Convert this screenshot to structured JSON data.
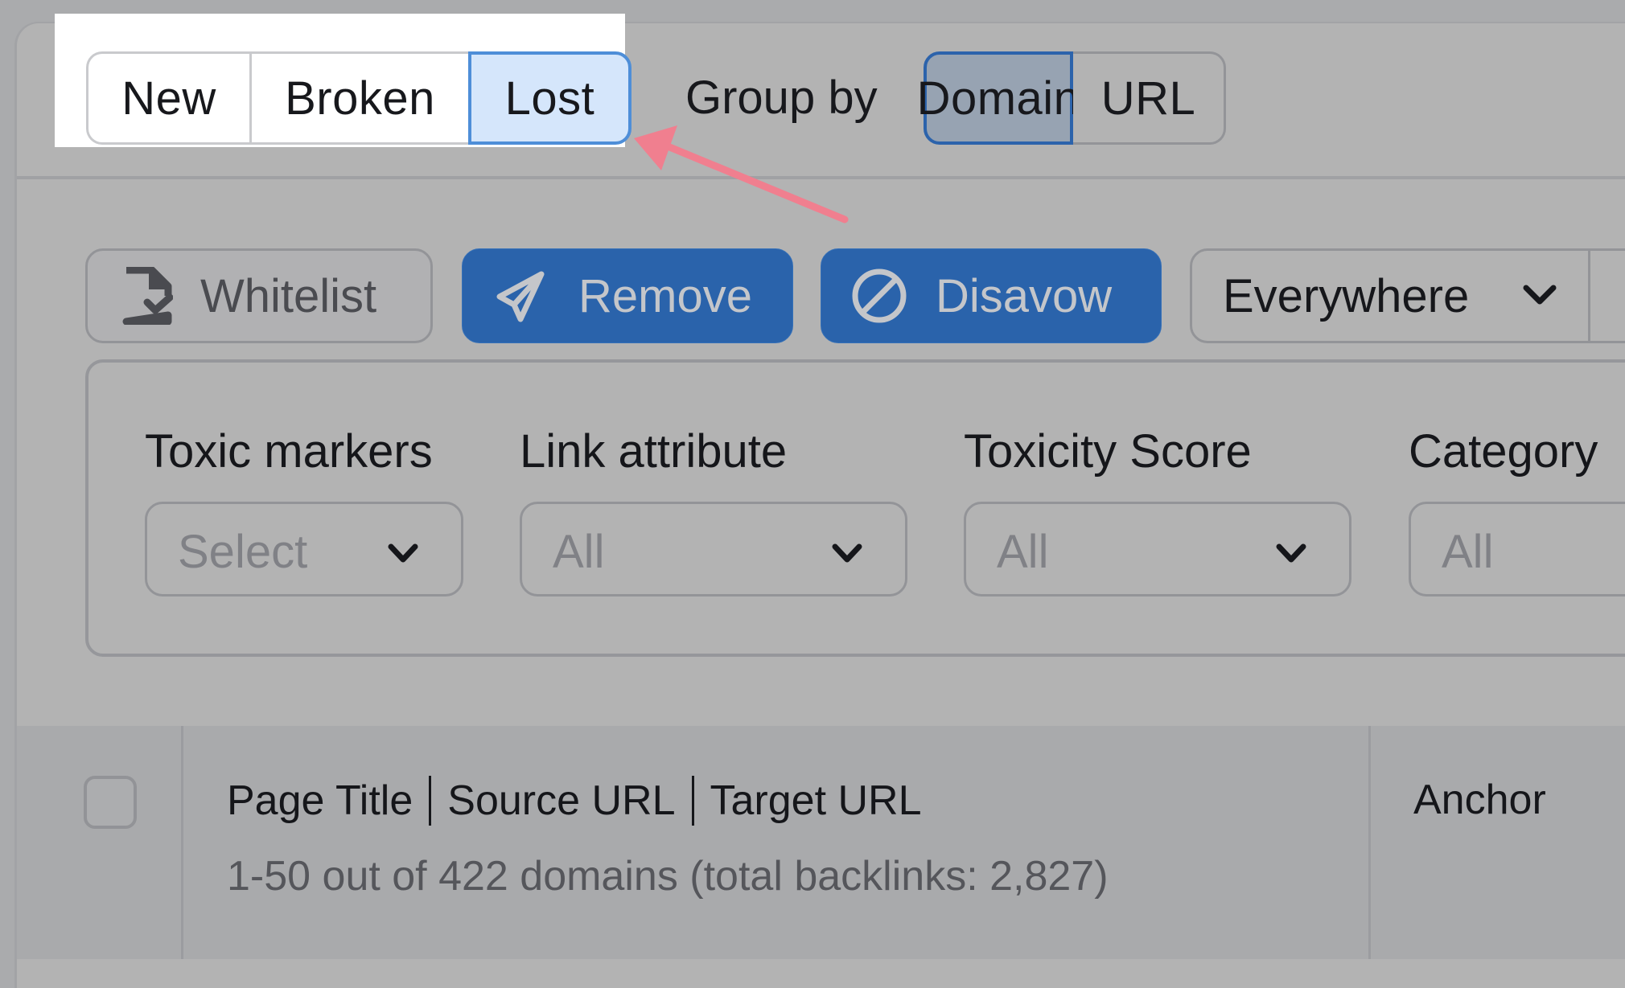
{
  "tabs": {
    "options": [
      "New",
      "Broken",
      "Lost"
    ],
    "selected": "Lost"
  },
  "group_by": {
    "label": "Group by",
    "options": [
      "Domain",
      "URL"
    ],
    "selected": "Domain"
  },
  "actions": {
    "whitelist_label": "Whitelist",
    "remove_label": "Remove",
    "disavow_label": "Disavow",
    "scope_dropdown_value": "Everywhere"
  },
  "filters": [
    {
      "label": "Toxic markers",
      "value": "Select"
    },
    {
      "label": "Link attribute",
      "value": "All"
    },
    {
      "label": "Toxicity Score",
      "value": "All"
    },
    {
      "label": "Category",
      "value": "All"
    }
  ],
  "table": {
    "column_main_parts": [
      "Page Title",
      "Source URL",
      "Target URL"
    ],
    "summary": "1-50 out of 422 domains (total backlinks: 2,827)",
    "column_anchor": "Anchor"
  },
  "colors": {
    "primary_blue": "#2a63ab",
    "selected_tab_bg": "#d5e6fb",
    "selected_tab_border": "#4e8ed8",
    "annotation_arrow": "#f07f8f"
  }
}
